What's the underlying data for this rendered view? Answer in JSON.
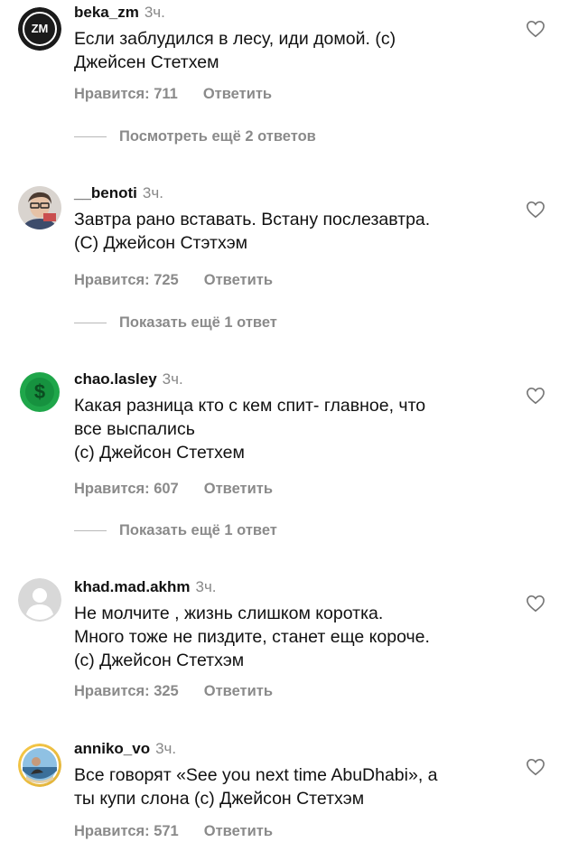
{
  "comments": [
    {
      "username": "beka_zm",
      "time": "3ч.",
      "lines": [
        "Если заблудился в лесу, иди домой. (с)",
        "Джейсен Стетхем"
      ],
      "likes": "Нравится: 711",
      "reply": "Ответить",
      "more": "Посмотреть ещё 2 ответов",
      "avatar_icon": "zm-logo"
    },
    {
      "username": "__benoti",
      "time": "3ч.",
      "lines": [
        "Завтра рано вставать. Встану послезавтра.",
        "(С) Джейсон Стэтхэм"
      ],
      "likes": "Нравится: 725",
      "reply": "Ответить",
      "more": "Показать ещё 1 ответ",
      "avatar_icon": "person-photo"
    },
    {
      "username": "chao.lasley",
      "time": "3ч.",
      "lines": [
        "Какая разница кто с кем спит- главное, что",
        "все выспались",
        "(с) Джейсон Стетхем"
      ],
      "likes": "Нравится: 607",
      "reply": "Ответить",
      "more": "Показать ещё 1 ответ",
      "avatar_icon": "dollar-sign"
    },
    {
      "username": "khad.mad.akhm",
      "time": "3ч.",
      "lines": [
        "Не молчите , жизнь слишком коротка.",
        "Много тоже не пиздите, станет еще короче.",
        "(с) Джейсон Стетхэм"
      ],
      "likes": "Нравится: 325",
      "reply": "Ответить",
      "avatar_icon": "default-user"
    },
    {
      "username": "anniko_vo",
      "time": "3ч.",
      "lines": [
        "Все говорят «See you next time AbuDhabi», а",
        "ты купи слона (с) Джейсон Стетхэм"
      ],
      "likes": "Нравится: 571",
      "reply": "Ответить",
      "avatar_icon": "beach-photo"
    }
  ]
}
